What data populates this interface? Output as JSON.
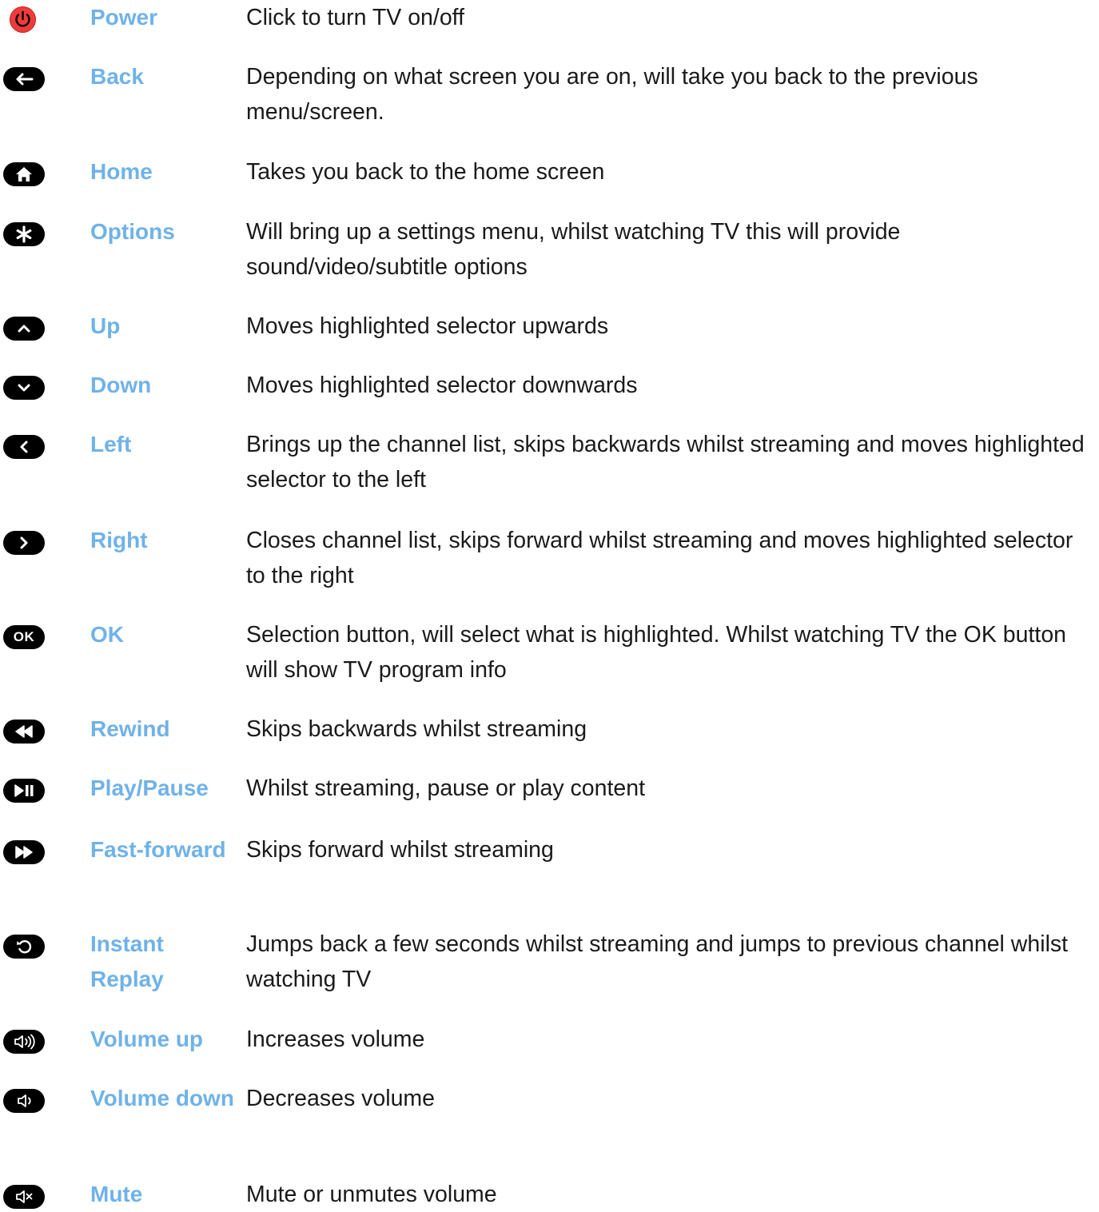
{
  "rows": [
    {
      "label": "Power",
      "description": "Click to turn TV on/off",
      "icon": "power-icon"
    },
    {
      "label": "Back",
      "description": "Depending on what screen you are on, will take you back to the previous menu/screen.",
      "icon": "back-arrow-icon"
    },
    {
      "label": "Home",
      "description": "Takes you back to the home screen",
      "icon": "home-icon"
    },
    {
      "label": "Options",
      "description": "Will bring up a settings menu, whilst watching TV this will provide sound/video/subtitle options",
      "icon": "asterisk-icon"
    },
    {
      "label": "Up",
      "description": "Moves highlighted selector upwards",
      "icon": "chevron-up-icon"
    },
    {
      "label": "Down",
      "description": "Moves highlighted selector downwards",
      "icon": "chevron-down-icon"
    },
    {
      "label": "Left",
      "description": "Brings up the channel list, skips backwards whilst streaming and moves highlighted selector to the left",
      "icon": "chevron-left-icon"
    },
    {
      "label": "Right",
      "description": "Closes channel list, skips forward whilst streaming and moves highlighted selector to the right",
      "icon": "chevron-right-icon"
    },
    {
      "label": "OK",
      "description": "Selection button, will select what is highlighted. Whilst watching TV the OK button will show TV program info",
      "icon": "ok-icon",
      "icon_text": "OK"
    },
    {
      "label": "Rewind",
      "description": "Skips backwards whilst streaming",
      "icon": "rewind-icon"
    },
    {
      "label": "Play/Pause",
      "description": "Whilst streaming, pause or play content",
      "icon": "play-pause-icon"
    },
    {
      "label": "Fast-forward",
      "description": "Skips forward whilst streaming",
      "icon": "fast-forward-icon"
    },
    {
      "label": "Instant Replay",
      "description": "Jumps back a few seconds whilst streaming and jumps to previous channel whilst watching TV",
      "icon": "instant-replay-icon"
    },
    {
      "label": "Volume up",
      "description": "Increases volume",
      "icon": "volume-up-icon"
    },
    {
      "label": "Volume down",
      "description": "Decreases volume",
      "icon": "volume-down-icon"
    },
    {
      "label": "Mute",
      "description": "Mute or unmutes volume",
      "icon": "mute-icon"
    }
  ],
  "colors": {
    "label": "#6fb2e8",
    "description": "#1a1a1a",
    "icon_background": "#000000",
    "power_icon": "#ef3b3b"
  }
}
